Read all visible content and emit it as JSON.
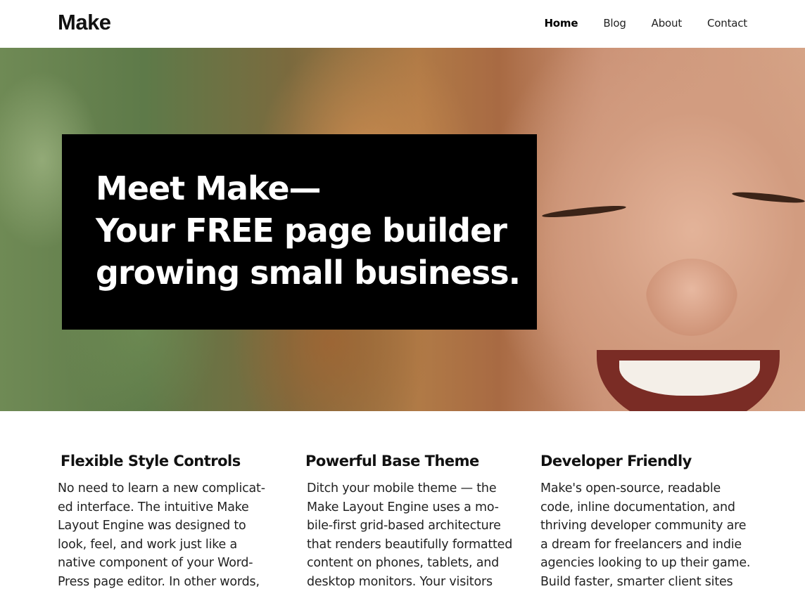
{
  "header": {
    "logo": "Make",
    "nav": [
      {
        "label": "Home",
        "active": true
      },
      {
        "label": "Blog",
        "active": false
      },
      {
        "label": "About",
        "active": false
      },
      {
        "label": "Contact",
        "active": false
      }
    ]
  },
  "hero": {
    "title_lines": [
      "Meet Make—",
      "Your FREE page builder",
      "growing small business."
    ]
  },
  "features": [
    {
      "title": "Flexible Style Controls",
      "body": "No need to learn a new complicat-\ned interface. The intuitive Make\nLayout Engine was designed to\nlook, feel, and work just like a\nnative component of your Word-\nPress page editor. In other words,"
    },
    {
      "title": "Powerful Base Theme",
      "body": "Ditch your mobile theme — the\nMake Layout Engine uses a mo-\nbile-first grid-based architecture\nthat renders beautifully formatted\ncontent on phones, tablets, and\ndesktop monitors. Your visitors"
    },
    {
      "title": "Developer Friendly",
      "body": "Make's open-source, readable\ncode, inline documentation, and\nthriving developer community are\na dream for freelancers and indie\nagencies looking to up their game.\nBuild faster, smarter client sites"
    }
  ],
  "colors": {
    "hero_box": "#000000",
    "hero_text": "#ffffff",
    "text": "#222222"
  },
  "icons": []
}
